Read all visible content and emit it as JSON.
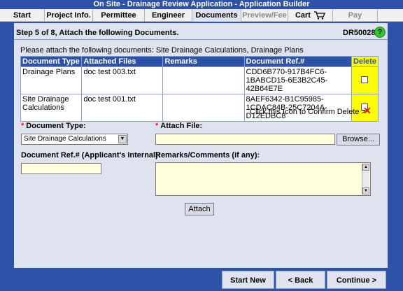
{
  "window": {
    "title": "On Site - Drainage Review Application - Application Builder"
  },
  "tabs": [
    {
      "label": "Start",
      "state": "normal"
    },
    {
      "label": "Project Info.",
      "state": "normal"
    },
    {
      "label": "Permittee",
      "state": "normal"
    },
    {
      "label": "Engineer",
      "state": "normal"
    },
    {
      "label": "Documents",
      "state": "active"
    },
    {
      "label": "Preview/Fee",
      "state": "disabled"
    },
    {
      "label": "Cart",
      "state": "normal",
      "icon": "cart-icon"
    },
    {
      "label": "Pay",
      "state": "disabled"
    }
  ],
  "step": {
    "title": "Step 5 of 8, Attach the following Documents.",
    "doc_id": "DR50028",
    "help_label": "?"
  },
  "instructions": "Please attach the following documents: Site Drainage Calculations, Drainage Plans",
  "table": {
    "headers": [
      "Document Type",
      "Attached Files",
      "Remarks",
      "Document Ref.#",
      "Delete"
    ],
    "rows": [
      {
        "type": "Drainage Plans",
        "file": "doc test 003.txt",
        "remarks": "",
        "ref": "CDD6B770-917B4FC6-1BABCD15-6E3B2C45-42B64E7E"
      },
      {
        "type": "Site Drainage Calculations",
        "file": "doc test 001.txt",
        "remarks": "",
        "ref": "8AEF6342-B1C95985-1CDAC84B-25C7204A-D12EDBC8"
      }
    ]
  },
  "confirm_delete": {
    "text": "Click this Icon to Confirm Delete >",
    "icon": "red-x-icon",
    "symbol": "✕"
  },
  "form": {
    "doc_type_label": "Document Type:",
    "doc_type_value": "Site Drainage Calculations",
    "attach_file_label": "Attach File:",
    "attach_file_value": "",
    "browse_label": "Browse...",
    "doc_ref_label": "Document Ref.# (Applicant's Internal):",
    "doc_ref_value": "",
    "remarks_label": "Remarks/Comments (if any):",
    "remarks_value": "",
    "attach_label": "Attach",
    "required_marker": "*"
  },
  "footer": {
    "start_new": "Start New",
    "back": "< Back",
    "continue": "Continue >"
  },
  "colors": {
    "frame_blue": "#2d52a8",
    "panel": "#dfe3f0",
    "field_yellow": "#ffffdd",
    "delete_yellow": "#ffff00",
    "help_green": "#33c433",
    "required_red": "#e21a1a"
  }
}
